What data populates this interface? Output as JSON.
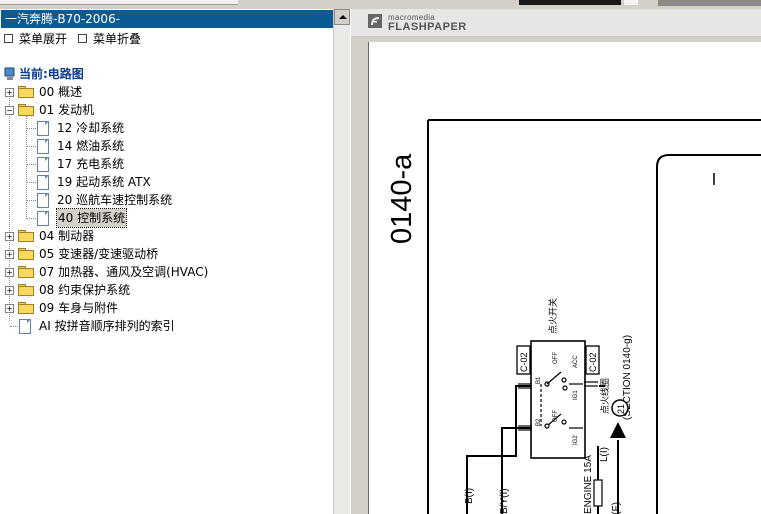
{
  "app": {
    "title": "一汽奔腾-B70-2006-"
  },
  "menu": {
    "expand_label": "菜单展开",
    "collapse_label": "菜单折叠"
  },
  "tree": {
    "current": "当前:电路图",
    "items": [
      {
        "label": "00 概述"
      },
      {
        "label": "01 发动机"
      },
      {
        "label": "12 冷却系统"
      },
      {
        "label": "14 燃油系统"
      },
      {
        "label": "17 充电系统"
      },
      {
        "label": "19 起动系统 ATX"
      },
      {
        "label": "20 巡航车速控制系统"
      },
      {
        "label": "40 控制系统"
      },
      {
        "label": "04 制动器"
      },
      {
        "label": "05 变速器/变速驱动桥"
      },
      {
        "label": "07 加热器、通风及空调(HVAC)"
      },
      {
        "label": "08 约束保护系统"
      },
      {
        "label": "09 车身与附件"
      },
      {
        "label": "AI 按拼音顺序排列的索引"
      }
    ],
    "selected_index": 7
  },
  "viewer": {
    "brand_small": "macromedia",
    "brand_large": "FLASHPAPER"
  },
  "diagram": {
    "page_code": "0140-a",
    "switch_label": "点火开关",
    "connector_left": "C-02",
    "connector_right": "C-02",
    "pos_off": "OFF",
    "pos_acc": "ACC",
    "pin_b1": "B1",
    "pin_b2": "B2",
    "pin_ig1": "IG1",
    "pin_ig2": "IG2",
    "pin_off": "OFF",
    "ref_text": "点火线圈",
    "section_ref": "(SECTION 0140-g)",
    "circle_num": "21",
    "wire_b": "B(I)",
    "wire_by": "B/Y(I)",
    "wire_l": "L(I)",
    "fuse_label": "ENGINE 15A",
    "wire_rf": "R(F)"
  },
  "colors": {
    "title_bg": "#0a5b93",
    "accent": "#0a3c8c"
  }
}
